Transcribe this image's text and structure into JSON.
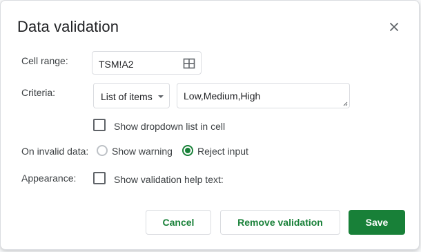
{
  "dialog": {
    "title": "Data validation",
    "close_icon": "close-icon"
  },
  "cell_range": {
    "label": "Cell range:",
    "value": "TSM!A2",
    "icon": "grid-select-icon"
  },
  "criteria": {
    "label": "Criteria:",
    "type_selected": "List of items",
    "items_value": "Low,Medium,High",
    "show_dropdown_label": "Show dropdown list in cell",
    "show_dropdown_checked": false
  },
  "invalid_data": {
    "label": "On invalid data:",
    "options": [
      {
        "label": "Show warning",
        "selected": false
      },
      {
        "label": "Reject input",
        "selected": true
      }
    ]
  },
  "appearance": {
    "label": "Appearance:",
    "help_text_label": "Show validation help text:",
    "help_text_checked": false
  },
  "buttons": {
    "cancel": "Cancel",
    "remove": "Remove validation",
    "save": "Save"
  },
  "colors": {
    "accent_green": "#188038",
    "border": "#dadce0"
  }
}
